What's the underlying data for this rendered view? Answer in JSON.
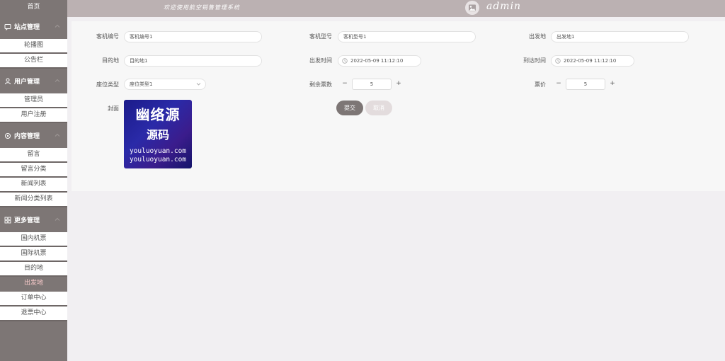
{
  "header": {
    "welcome_text": "欢迎使用航空销售管理系统",
    "username": "admin"
  },
  "sidebar": {
    "home_label": "首页",
    "groups": [
      {
        "label": "站点管理",
        "items": [
          "轮播图",
          "公告栏"
        ]
      },
      {
        "label": "用户管理",
        "items": [
          "管理员",
          "用户注册"
        ]
      },
      {
        "label": "内容管理",
        "items": [
          "留言",
          "留言分类",
          "新闻列表",
          "新闻分类列表"
        ]
      },
      {
        "label": "更多管理",
        "items": [
          "国内机票",
          "国际机票",
          "目的地",
          "出发地",
          "订单中心",
          "退票中心"
        ]
      }
    ],
    "active_item": "出发地"
  },
  "form": {
    "flight_no_label": "客机编号",
    "flight_no_value": "客机编号1",
    "flight_model_label": "客机型号",
    "flight_model_value": "客机型号1",
    "origin_label": "出发地",
    "origin_value": "出发地1",
    "destination_label": "目的地",
    "destination_value": "目的地1",
    "depart_time_label": "出发时间",
    "depart_time_value": "2022-05-09 11:12:10",
    "arrive_time_label": "到达时间",
    "arrive_time_value": "2022-05-09 11:12:10",
    "seat_type_label": "座位类型",
    "seat_type_value": "座位类型1",
    "remaining_tickets_label": "剩余票数",
    "remaining_tickets_value": "5",
    "price_label": "票价",
    "price_value": "5",
    "cover_label": "封面",
    "cover_image_text": {
      "line1": "幽络源",
      "line2": "源码",
      "line3": "youluoyuan.com",
      "line4": "youluoyuan.com"
    },
    "submit_label": "提交",
    "cancel_label": "取消",
    "stepper_minus": "−",
    "stepper_plus": "+"
  },
  "colors": {
    "sidebar_bg": "#7d7675",
    "topbar_bg": "#bbb1b2",
    "active_text": "#f6c8c8",
    "submit_bg": "#7d7675",
    "cancel_bg": "#e3dcdd"
  }
}
